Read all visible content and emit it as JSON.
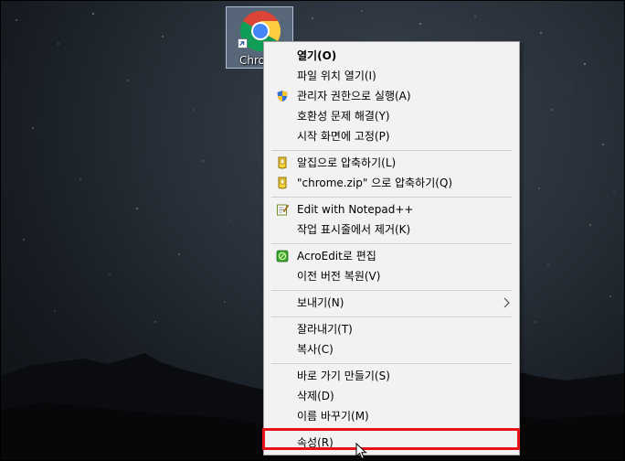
{
  "desktop": {
    "icon_label": "Chro",
    "icon_name": "chrome-icon"
  },
  "menu": {
    "items": [
      {
        "label": "열기(O)",
        "bold": true
      },
      {
        "label": "파일 위치 열기(I)"
      },
      {
        "label": "관리자 권한으로 실행(A)",
        "icon": "shield-icon"
      },
      {
        "label": "호환성 문제 해결(Y)"
      },
      {
        "label": "시작 화면에 고정(P)"
      },
      {
        "label": "알집으로 압축하기(L)",
        "icon": "alzip-icon"
      },
      {
        "label": "\"chrome.zip\" 으로 압축하기(Q)",
        "icon": "alzip-icon"
      },
      {
        "label": "Edit with Notepad++",
        "icon": "notepad-icon"
      },
      {
        "label": "작업 표시줄에서 제거(K)"
      },
      {
        "label": "AcroEdit로 편집",
        "icon": "acroedit-icon"
      },
      {
        "label": "이전 버전 복원(V)"
      },
      {
        "label": "보내기(N)",
        "submenu": true
      },
      {
        "label": "잘라내기(T)"
      },
      {
        "label": "복사(C)"
      },
      {
        "label": "바로 가기 만들기(S)"
      },
      {
        "label": "삭제(D)"
      },
      {
        "label": "이름 바꾸기(M)"
      },
      {
        "label": "속성(R)"
      }
    ]
  },
  "colors": {
    "highlight_border": "#e6131a",
    "menu_background": "#f2f2f2"
  }
}
